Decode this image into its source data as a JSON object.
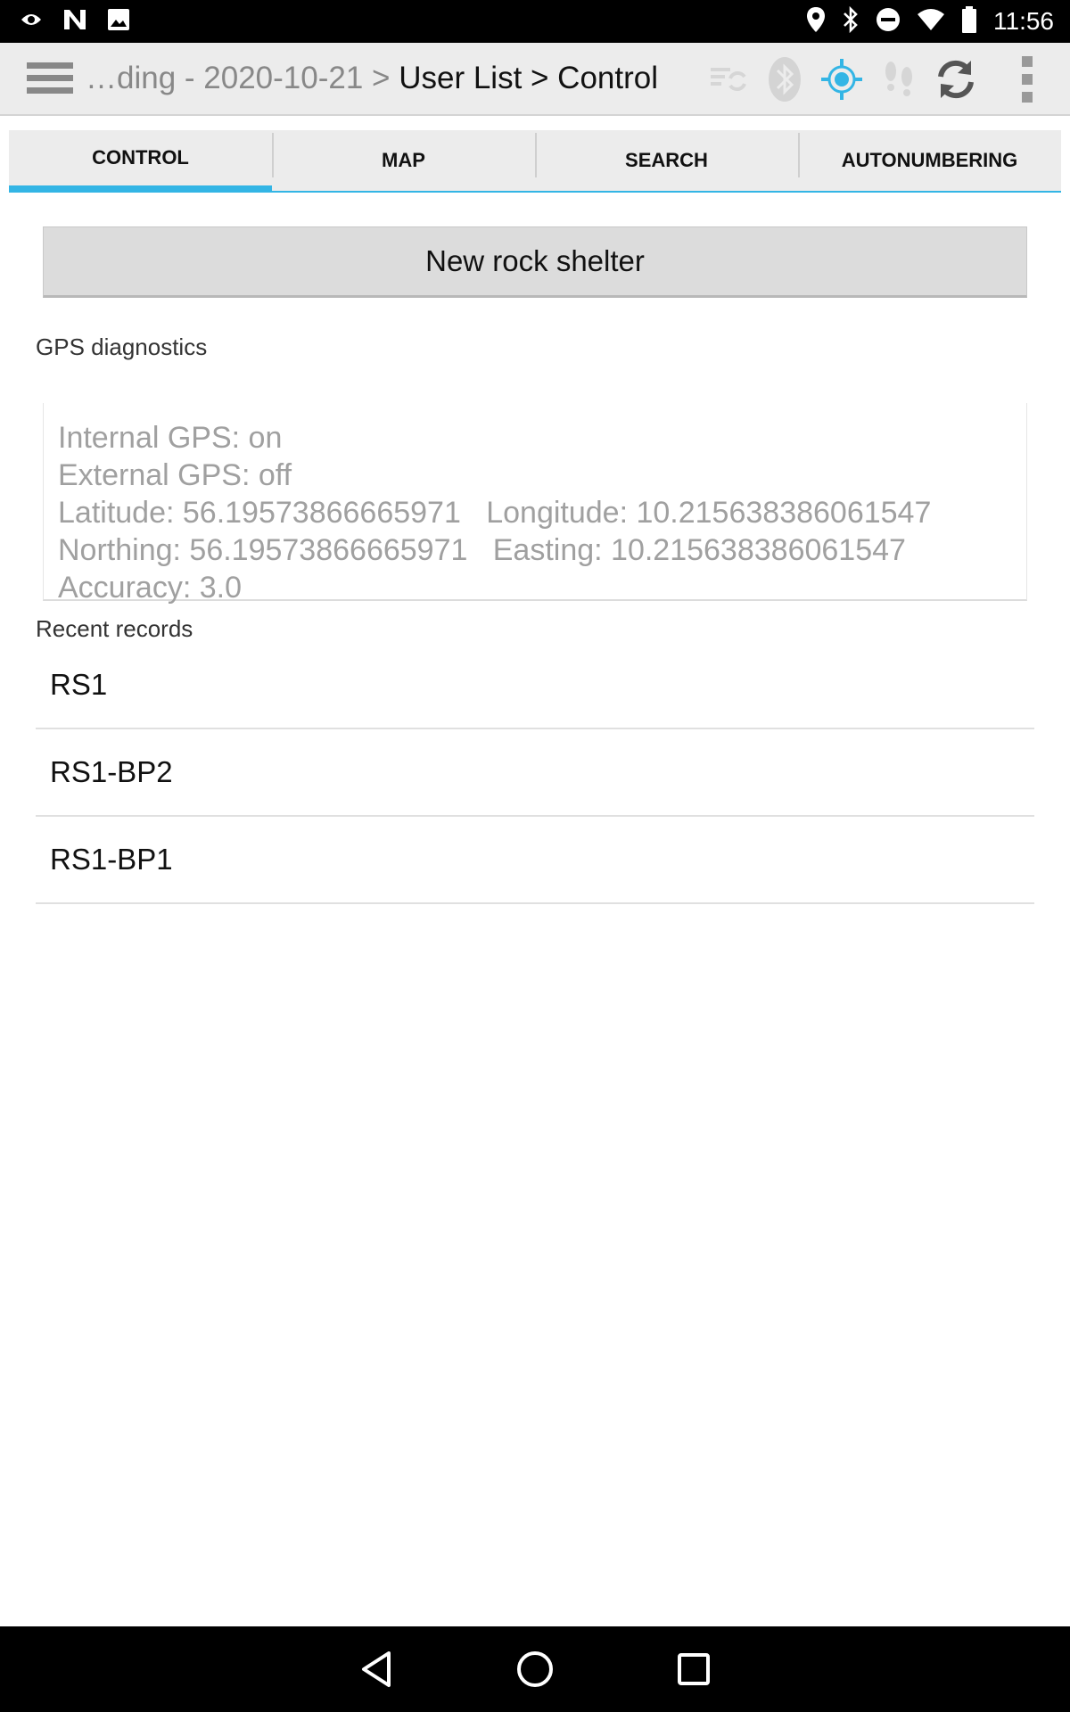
{
  "status_bar": {
    "time": "11:56",
    "left_icons": [
      "eye-icon",
      "n-logo-icon",
      "image-icon"
    ],
    "right_icons": [
      "location-icon",
      "bluetooth-icon",
      "do-not-disturb-icon",
      "wifi-icon",
      "battery-icon"
    ]
  },
  "action_bar": {
    "breadcrumb_prefix": "…ding - 2020-10-21 > ",
    "breadcrumb_current": "User List > Control",
    "icons": [
      "sync-status-icon",
      "bluetooth-icon",
      "gps-target-icon",
      "footsteps-icon",
      "refresh-icon",
      "overflow-menu-icon"
    ],
    "accent": "#33b5e5"
  },
  "tabs": [
    {
      "label": "CONTROL",
      "active": true
    },
    {
      "label": "MAP",
      "active": false
    },
    {
      "label": "SEARCH",
      "active": false
    },
    {
      "label": "AUTONUMBERING",
      "active": false
    }
  ],
  "control": {
    "new_button_label": "New rock shelter",
    "gps_label": "GPS diagnostics",
    "gps_lines": [
      "Internal GPS: on",
      "External GPS: off",
      "Latitude: 56.19573866665971   Longitude: 10.215638386061547",
      "Northing: 56.19573866665971   Easting: 10.215638386061547",
      "Accuracy: 3.0"
    ],
    "recent_label": "Recent records",
    "records": [
      "RS1",
      "RS1-BP2",
      "RS1-BP1"
    ]
  },
  "nav_bar": {
    "icons": [
      "back-icon",
      "home-icon",
      "recents-icon"
    ]
  }
}
